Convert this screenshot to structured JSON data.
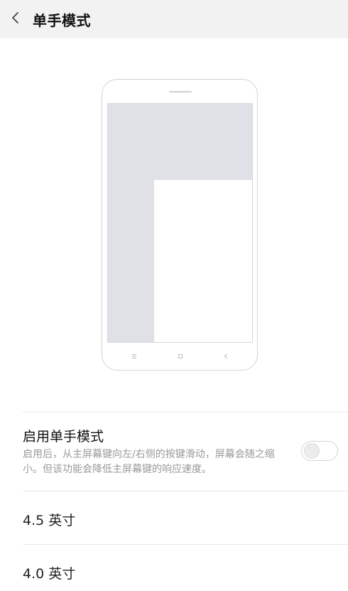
{
  "header": {
    "title": "单手模式",
    "back_icon": "chevron-left-icon"
  },
  "illustration": {
    "nav_icons": [
      "menu-icon",
      "home-square-icon",
      "back-triangle-icon"
    ],
    "screen_color": "#dfe1e7"
  },
  "enable_row": {
    "title": "启用单手模式",
    "description": "启用后，从主屏幕键向左/右侧的按键滑动，屏幕会随之缩小。但该功能会降低主屏幕键的响应速度。",
    "toggle_state": "off"
  },
  "size_options": [
    {
      "label": "4.5 英寸"
    },
    {
      "label": "4.0 英寸"
    }
  ]
}
